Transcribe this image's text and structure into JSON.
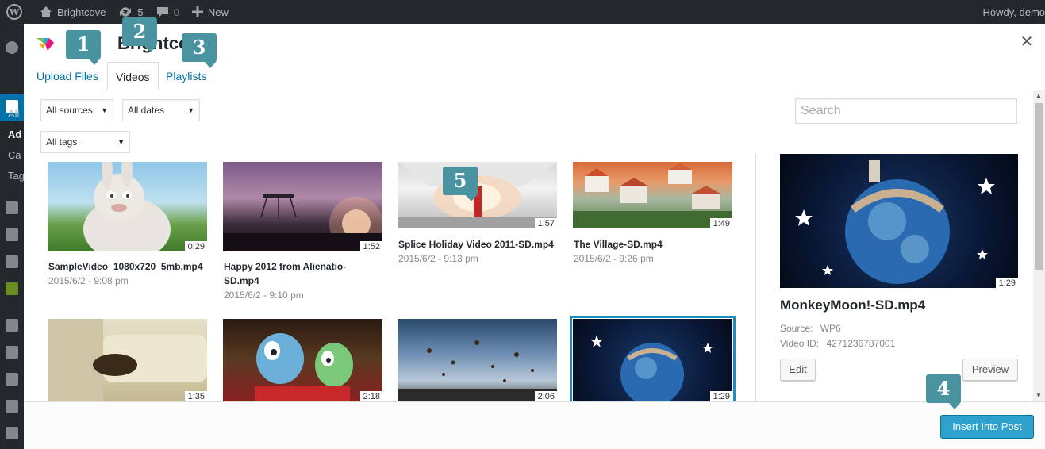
{
  "admin_bar": {
    "site_name": "Brightcove",
    "updates_count": "5",
    "comments_count": "0",
    "new_label": "New",
    "greeting": "Howdy, demo"
  },
  "side_menu": {
    "partial_labels": [
      "All",
      "Ad",
      "Ca",
      "Tag"
    ]
  },
  "modal": {
    "title": "Brightcove",
    "tabs": [
      {
        "label": "Upload Files",
        "active": false
      },
      {
        "label": "Videos",
        "active": true
      },
      {
        "label": "Playlists",
        "active": false
      }
    ],
    "callouts": [
      "1",
      "2",
      "3",
      "4",
      "5"
    ]
  },
  "filters": {
    "sources": "All sources",
    "dates": "All dates",
    "tags": "All tags",
    "search_placeholder": "Search"
  },
  "videos": [
    {
      "name": "SampleVideo_1080x720_5mb.mp4",
      "date": "2015/6/2 - 9:08 pm",
      "duration": "0:29"
    },
    {
      "name": "Happy 2012 from Alienatio-SD.mp4",
      "name_line1": "Happy 2012 from Alienatio-",
      "name_line2": "SD.mp4",
      "date": "2015/6/2 - 9:10 pm",
      "duration": "1:52"
    },
    {
      "name": "Splice Holiday Video 2011-SD.mp4",
      "date": "2015/6/2 - 9:13 pm",
      "duration": "1:57"
    },
    {
      "name": "The Village-SD.mp4",
      "date": "2015/6/2 - 9:26 pm",
      "duration": "1:49"
    },
    {
      "duration": "1:35"
    },
    {
      "duration": "2:18"
    },
    {
      "duration": "2:06"
    },
    {
      "duration": "1:29",
      "selected": true
    }
  ],
  "details": {
    "name": "MonkeyMoon!-SD.mp4",
    "duration": "1:29",
    "source_label": "Source:",
    "source_value": "WP6",
    "video_id_label": "Video ID:",
    "video_id_value": "4271236787001",
    "edit_label": "Edit",
    "preview_label": "Preview"
  },
  "footer": {
    "insert_label": "Insert Into Post"
  },
  "colors": {
    "accent": "#0073aa",
    "primary_button": "#2ea2cc",
    "callout": "#4a93a0",
    "selection": "#1e8cbe"
  }
}
